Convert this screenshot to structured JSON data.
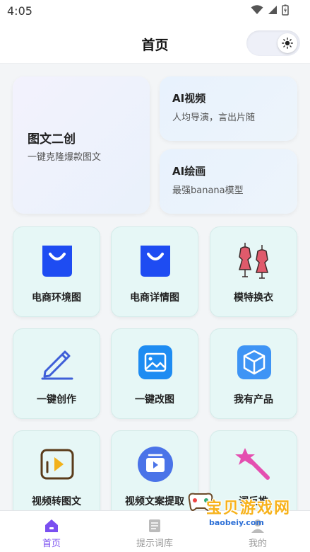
{
  "status": {
    "time": "4:05"
  },
  "header": {
    "title": "首页"
  },
  "features": {
    "big": {
      "title": "图文二创",
      "subtitle": "一键克隆爆款图文"
    },
    "video": {
      "title": "AI视频",
      "subtitle": "人均导演，言出片随"
    },
    "painting": {
      "title": "AI绘画",
      "subtitle": "最强banana模型"
    }
  },
  "tools": [
    {
      "label": "电商环境图",
      "icon": "shopping-bag-icon"
    },
    {
      "label": "电商详情图",
      "icon": "shopping-bag-icon"
    },
    {
      "label": "模特换衣",
      "icon": "mannequin-icon"
    },
    {
      "label": "一键创作",
      "icon": "pencil-icon"
    },
    {
      "label": "一键改图",
      "icon": "image-icon"
    },
    {
      "label": "我有产品",
      "icon": "cube-icon"
    },
    {
      "label": "视频转图文",
      "icon": "video-frame-icon"
    },
    {
      "label": "视频文案提取",
      "icon": "video-play-icon"
    },
    {
      "label": "词反推",
      "icon": "magic-wand-icon"
    }
  ],
  "tabs": [
    {
      "label": "首页",
      "icon": "home-icon",
      "active": true
    },
    {
      "label": "提示词库",
      "icon": "document-icon",
      "active": false
    },
    {
      "label": "我的",
      "icon": "user-icon",
      "active": false
    }
  ],
  "watermark": {
    "text": "宝贝游戏网",
    "url": "baobeiy.com"
  },
  "colors": {
    "accent": "#7a4ff0",
    "tile_bg": "#e6f7f6",
    "icon_blue": "#1e4cf2",
    "watermark": "#f7b21b"
  }
}
